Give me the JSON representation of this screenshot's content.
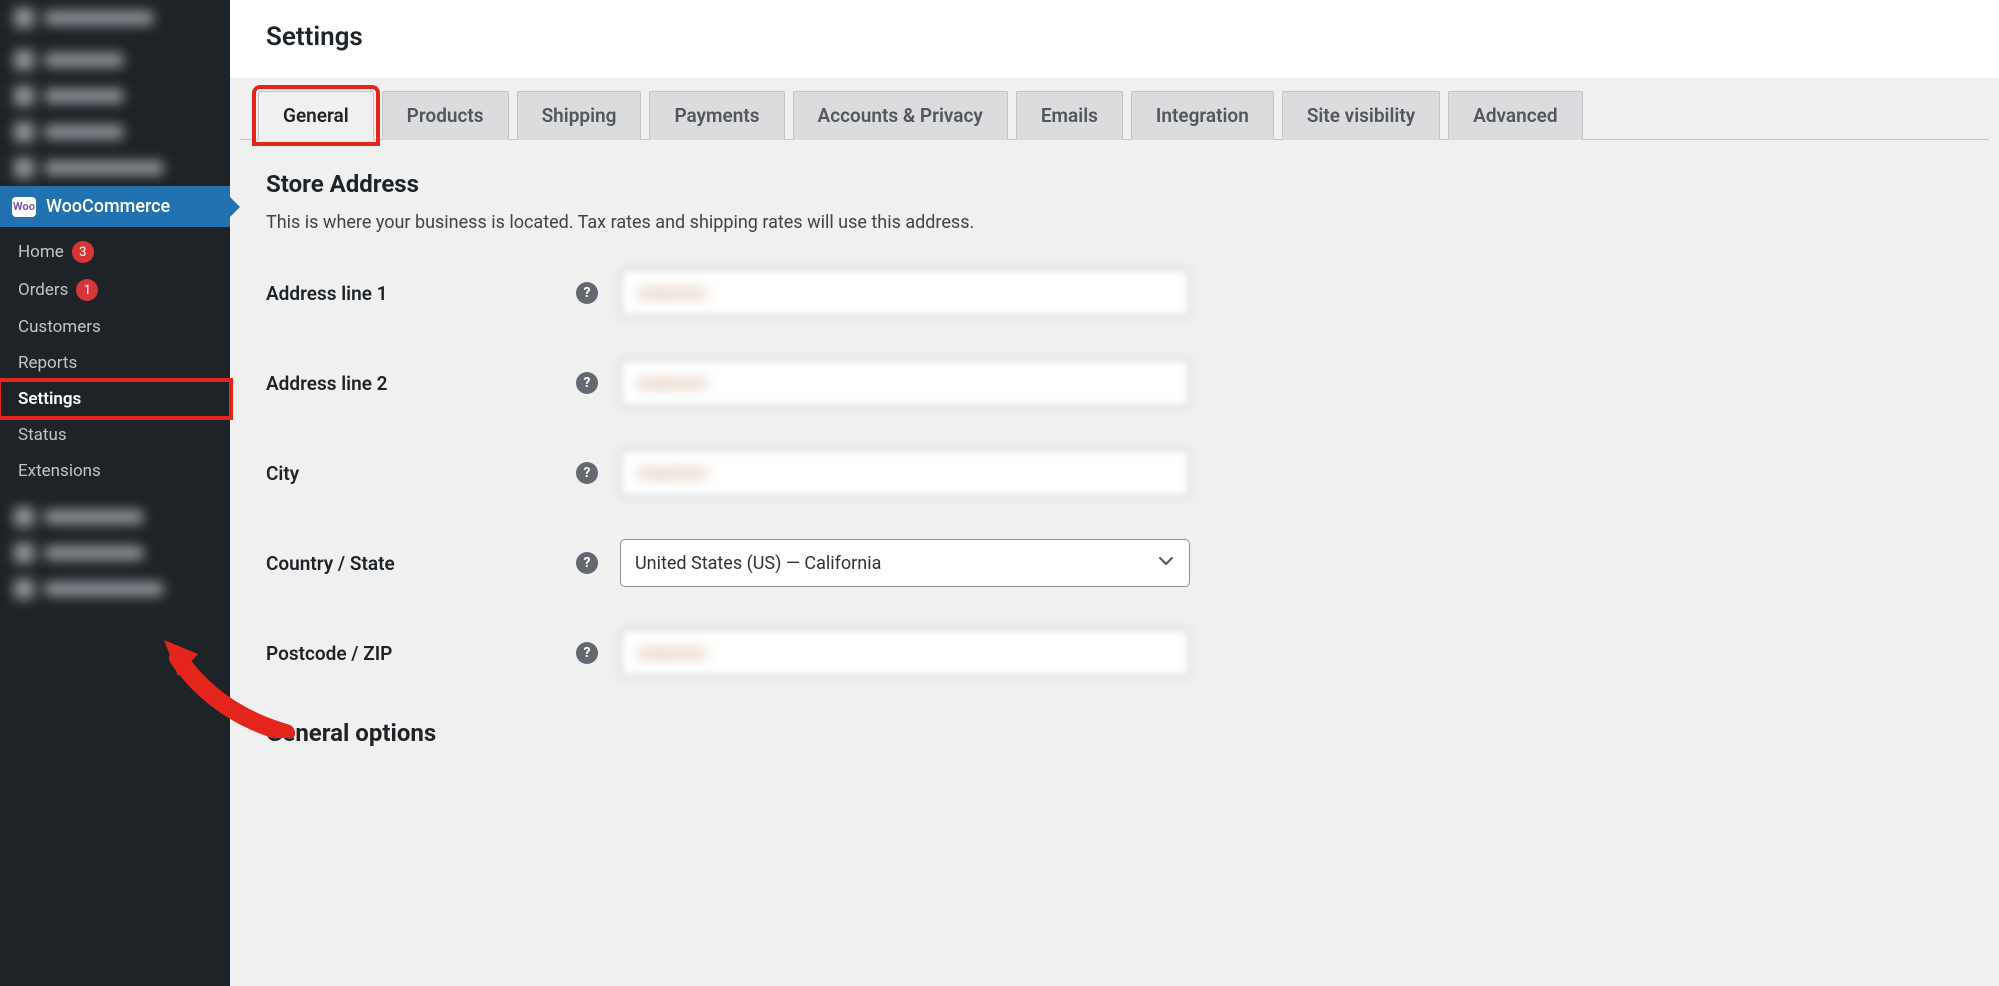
{
  "page": {
    "title": "Settings"
  },
  "sidebar": {
    "parent_label": "WooCommerce",
    "items": [
      {
        "label": "Home",
        "badge": "3",
        "current": false
      },
      {
        "label": "Orders",
        "badge": "1",
        "current": false
      },
      {
        "label": "Customers",
        "badge": "",
        "current": false
      },
      {
        "label": "Reports",
        "badge": "",
        "current": false
      },
      {
        "label": "Settings",
        "badge": "",
        "current": true,
        "highlighted": true
      },
      {
        "label": "Status",
        "badge": "",
        "current": false
      },
      {
        "label": "Extensions",
        "badge": "",
        "current": false
      }
    ]
  },
  "tabs": [
    {
      "label": "General",
      "active": true,
      "highlighted": true
    },
    {
      "label": "Products",
      "active": false,
      "highlighted": false
    },
    {
      "label": "Shipping",
      "active": false,
      "highlighted": false
    },
    {
      "label": "Payments",
      "active": false,
      "highlighted": false
    },
    {
      "label": "Accounts & Privacy",
      "active": false,
      "highlighted": false
    },
    {
      "label": "Emails",
      "active": false,
      "highlighted": false
    },
    {
      "label": "Integration",
      "active": false,
      "highlighted": false
    },
    {
      "label": "Site visibility",
      "active": false,
      "highlighted": false
    },
    {
      "label": "Advanced",
      "active": false,
      "highlighted": false
    }
  ],
  "store_address": {
    "heading": "Store Address",
    "description": "This is where your business is located. Tax rates and shipping rates will use this address.",
    "fields": {
      "address1_label": "Address line 1",
      "address1_value": "redacted",
      "address2_label": "Address line 2",
      "address2_value": "redacted",
      "city_label": "City",
      "city_value": "redacted",
      "country_label": "Country / State",
      "country_value": "United States (US) — California",
      "postcode_label": "Postcode / ZIP",
      "postcode_value": "redacted"
    },
    "general_options_heading": "General options"
  },
  "icons": {
    "help": "?",
    "woo": "Woo"
  }
}
